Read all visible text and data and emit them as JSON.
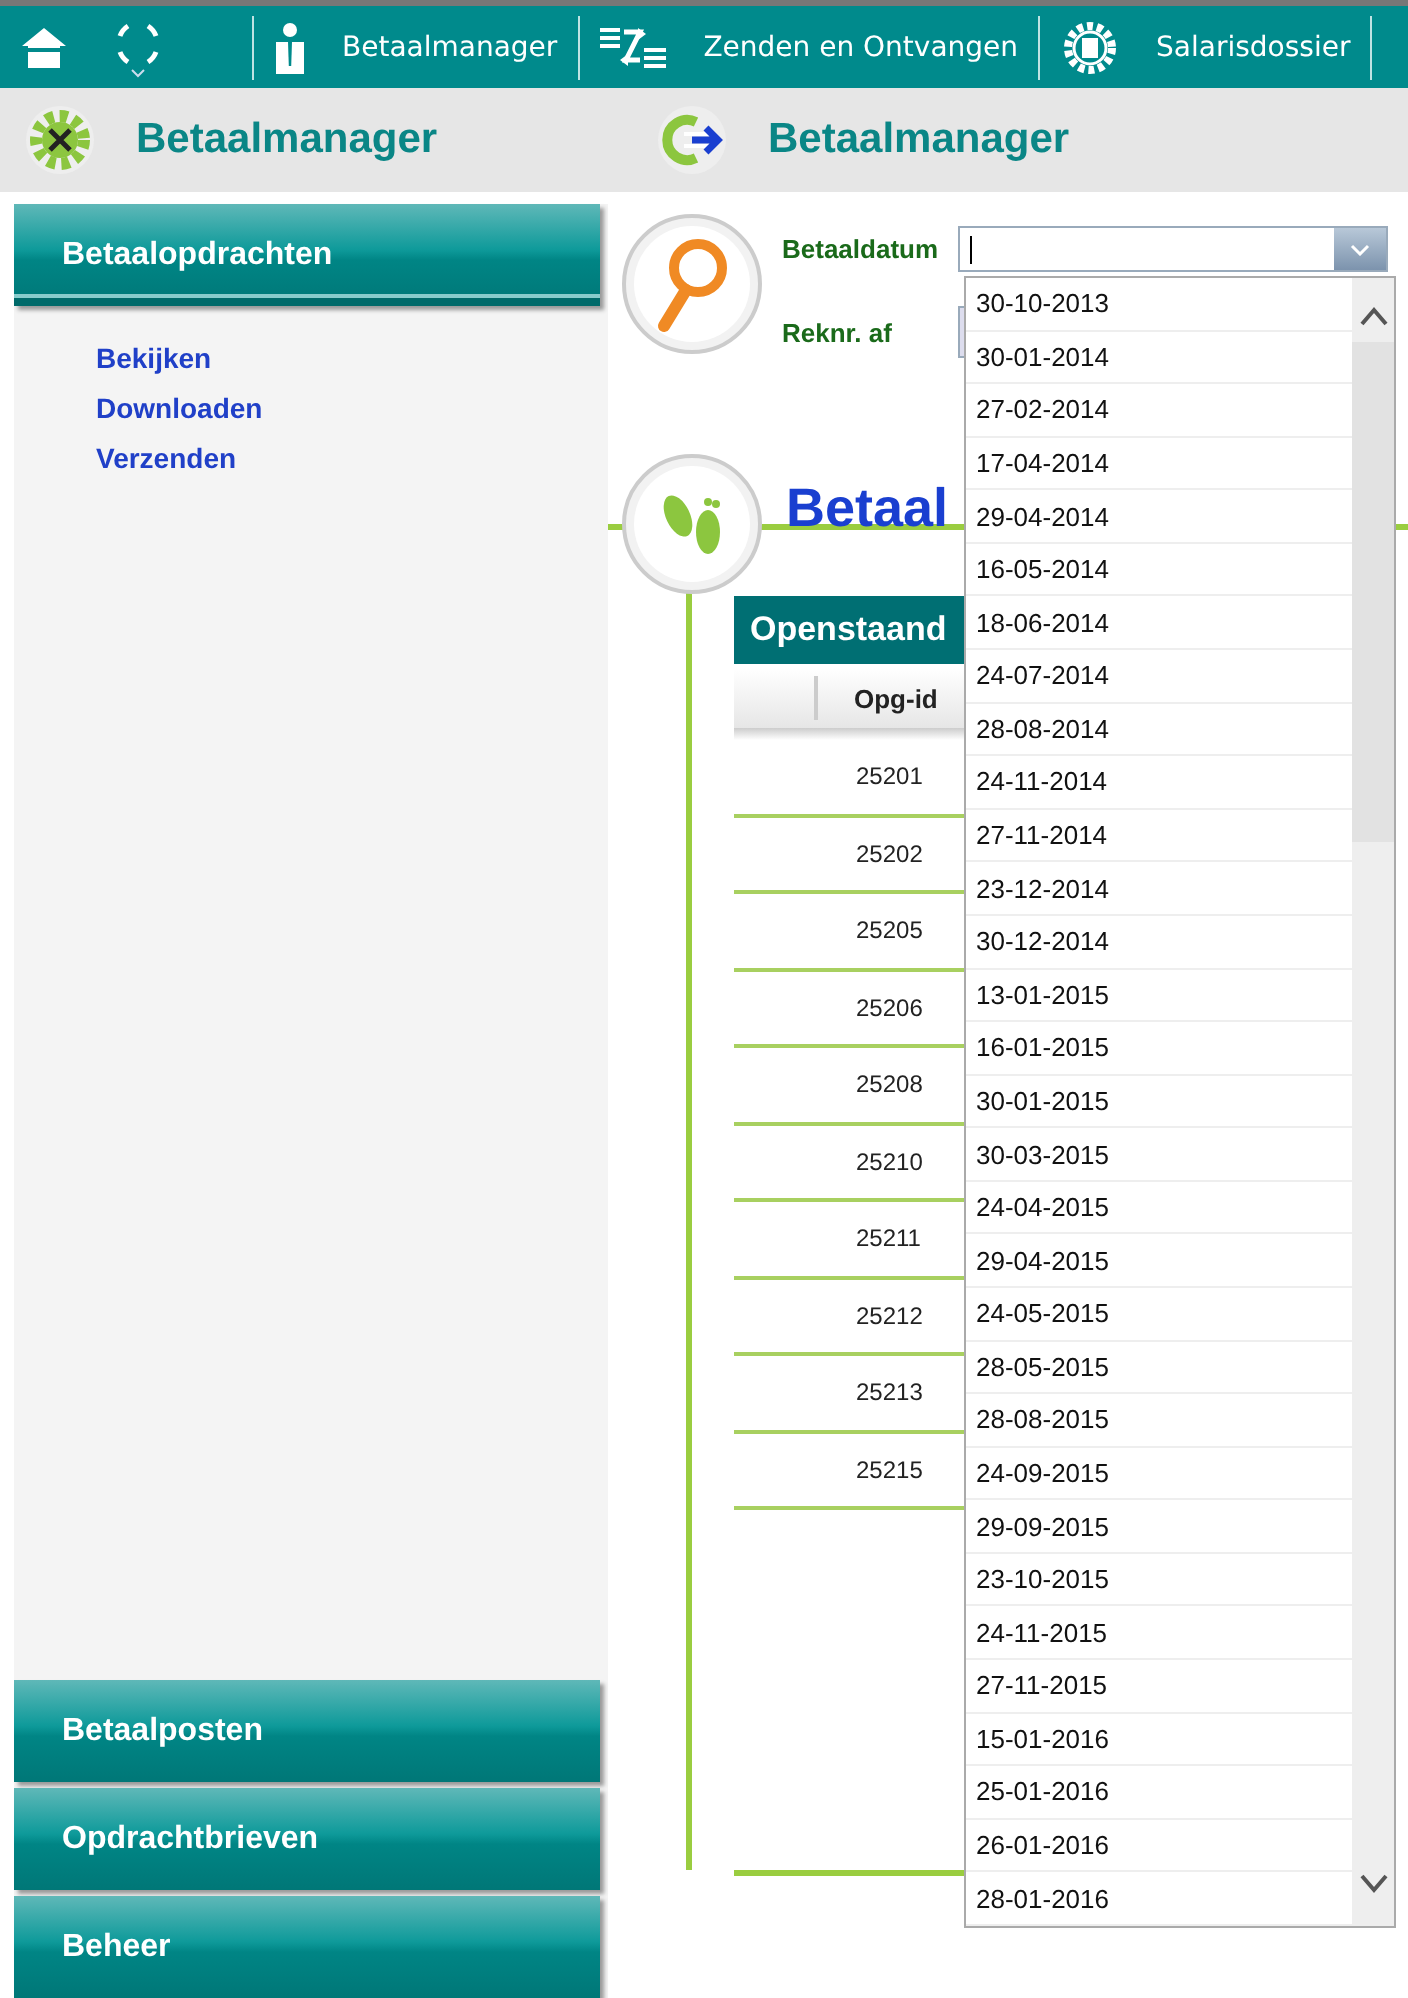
{
  "topbar": {
    "tabs": [
      {
        "kind": "person",
        "label": "Betaalmanager"
      },
      {
        "kind": "transfer",
        "label": "Zenden en Ontvangen"
      },
      {
        "kind": "gear",
        "label": "Salarisdossier"
      }
    ]
  },
  "subheader": {
    "left_title": "Betaalmanager",
    "right_title": "Betaalmanager"
  },
  "sidebar": {
    "sections": [
      {
        "label": "Betaalopdrachten",
        "expanded": true,
        "items": [
          "Bekijken",
          "Downloaden",
          "Verzenden"
        ]
      },
      {
        "label": "Betaalposten",
        "expanded": false
      },
      {
        "label": "Opdrachtbrieven",
        "expanded": false
      },
      {
        "label": "Beheer",
        "expanded": false
      }
    ]
  },
  "search": {
    "fields": [
      {
        "label": "Betaaldatum"
      },
      {
        "label": "Reknr. af"
      }
    ],
    "dropdown_options": [
      "30-10-2013",
      "30-01-2014",
      "27-02-2014",
      "17-04-2014",
      "29-04-2014",
      "16-05-2014",
      "18-06-2014",
      "24-07-2014",
      "28-08-2014",
      "24-11-2014",
      "27-11-2014",
      "23-12-2014",
      "30-12-2014",
      "13-01-2015",
      "16-01-2015",
      "30-01-2015",
      "30-03-2015",
      "24-04-2015",
      "29-04-2015",
      "24-05-2015",
      "28-05-2015",
      "28-08-2015",
      "24-09-2015",
      "29-09-2015",
      "23-10-2015",
      "24-11-2015",
      "27-11-2015",
      "15-01-2016",
      "25-01-2016",
      "26-01-2016",
      "28-01-2016"
    ]
  },
  "section": {
    "title": "Betaal",
    "table": {
      "title": "Openstaand",
      "columns": [
        "Opg-id"
      ],
      "rows": [
        "25201",
        "25202",
        "25205",
        "25206",
        "25208",
        "25210",
        "25211",
        "25212",
        "25213",
        "25215"
      ]
    }
  }
}
